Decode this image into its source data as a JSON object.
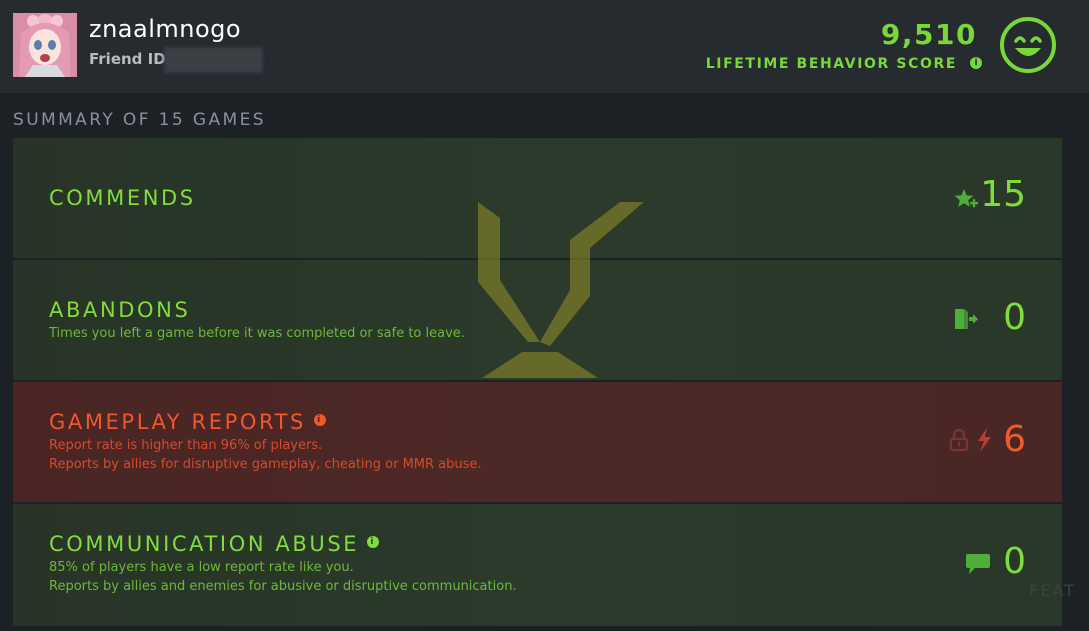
{
  "header": {
    "username": "znaalmnogo",
    "friend_id_label": "Friend ID:",
    "behavior_score": "9,510",
    "behavior_score_label": "LIFETIME BEHAVIOR SCORE",
    "behavior_icon": "smiley-icon",
    "accent_color": "#79d838"
  },
  "summary": {
    "title": "SUMMARY OF 15 GAMES"
  },
  "panels": {
    "commends": {
      "title": "COMMENDS",
      "value": "15",
      "icon": "star-plus-icon"
    },
    "abandons": {
      "title": "ABANDONS",
      "description": "Times you left a game before it was completed or safe to leave.",
      "value": "0",
      "icon": "exit-door-icon"
    },
    "gameplay_reports": {
      "title": "GAMEPLAY REPORTS",
      "line1": "Report rate is higher than 96% of players.",
      "line2": "Reports by allies for disruptive gameplay, cheating or MMR abuse.",
      "value": "6",
      "icons": [
        "lock-icon",
        "lightning-icon"
      ],
      "color": "#f0582c"
    },
    "communication_abuse": {
      "title": "COMMUNICATION ABUSE",
      "line1": "85% of players have a low report rate like you.",
      "line2": "Reports by allies and enemies for abusive or disruptive communication.",
      "value": "0",
      "icon": "chat-bubble-icon"
    }
  },
  "background_text": "FEAT"
}
